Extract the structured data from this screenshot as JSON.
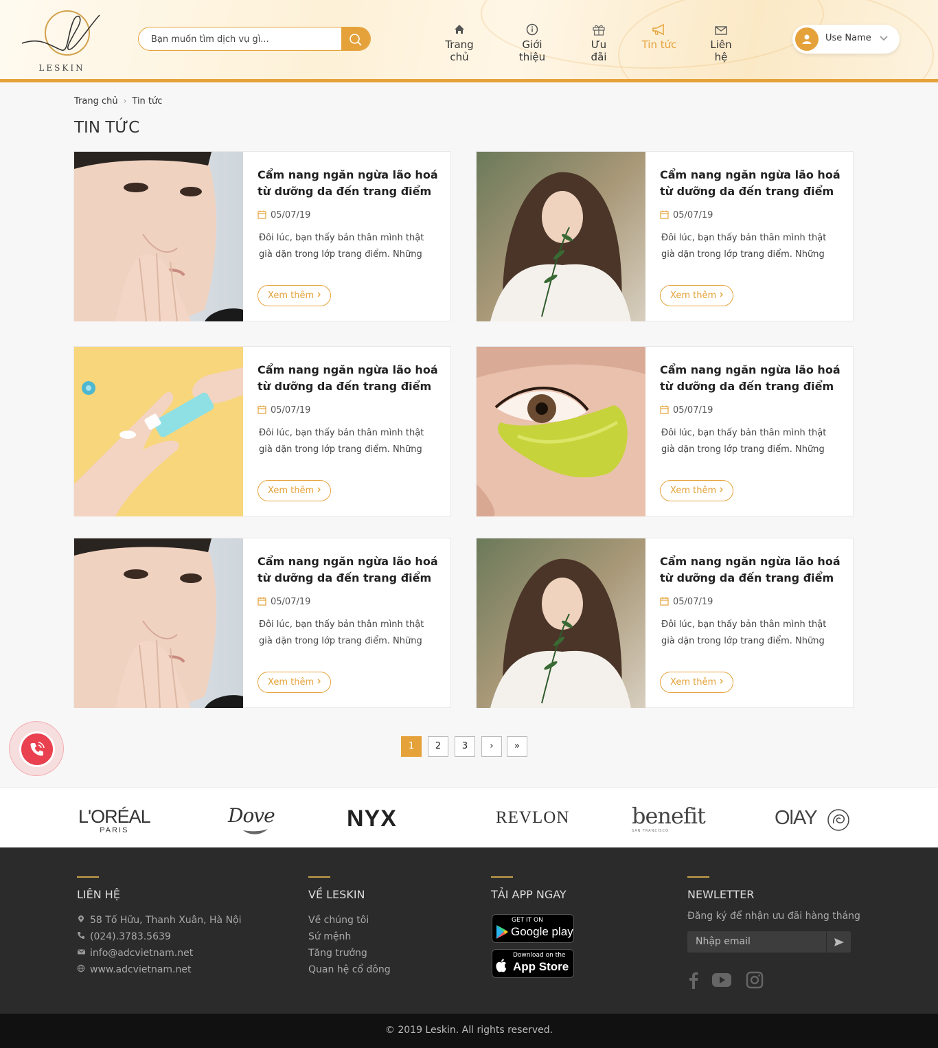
{
  "header": {
    "logo_text": "LESKIN",
    "search_placeholder": "Bạn muốn tìm dịch vụ gì...",
    "nav": [
      {
        "label": "Trang chủ",
        "icon": "home-icon"
      },
      {
        "label": "Giới thiệu",
        "icon": "info-icon"
      },
      {
        "label": "Ưu đãi",
        "icon": "gift-icon"
      },
      {
        "label": "Tin tức",
        "icon": "megaphone-icon",
        "active": true
      },
      {
        "label": "Liên hệ",
        "icon": "mail-icon"
      }
    ],
    "user_name": "Use Name"
  },
  "breadcrumb": {
    "home": "Trang chủ",
    "current": "Tin tức"
  },
  "page_title": "TIN TỨC",
  "articles": [
    {
      "title": "Cẩm nang ngăn ngừa lão hoá từ dưỡng da đến trang điểm",
      "date": "05/07/19",
      "excerpt": "Đôi lúc, bạn thấy bản thân mình thật già dặn trong lớp trang điểm. Những",
      "more": "Xem thêm",
      "image": "face-portrait"
    },
    {
      "title": "Cẩm nang ngăn ngừa lão hoá từ dưỡng da đến trang điểm",
      "date": "05/07/19",
      "excerpt": "Đôi lúc, bạn thấy bản thân mình thật già dặn trong lớp trang điểm. Những",
      "more": "Xem thêm",
      "image": "woman-with-plant"
    },
    {
      "title": "Cẩm nang ngăn ngừa lão hoá từ dưỡng da đến trang điểm",
      "date": "05/07/19",
      "excerpt": "Đôi lúc, bạn thấy bản thân mình thật già dặn trong lớp trang điểm. Những",
      "more": "Xem thêm",
      "image": "hand-cream"
    },
    {
      "title": "Cẩm nang ngăn ngừa lão hoá từ dưỡng da đến trang điểm",
      "date": "05/07/19",
      "excerpt": "Đôi lúc, bạn thấy bản thân mình thật già dặn trong lớp trang điểm. Những",
      "more": "Xem thêm",
      "image": "eye-patch"
    },
    {
      "title": "Cẩm nang ngăn ngừa lão hoá từ dưỡng da đến trang điểm",
      "date": "05/07/19",
      "excerpt": "Đôi lúc, bạn thấy bản thân mình thật già dặn trong lớp trang điểm. Những",
      "more": "Xem thêm",
      "image": "face-portrait"
    },
    {
      "title": "Cẩm nang ngăn ngừa lão hoá từ dưỡng da đến trang điểm",
      "date": "05/07/19",
      "excerpt": "Đôi lúc, bạn thấy bản thân mình thật già dặn trong lớp trang điểm. Những",
      "more": "Xem thêm",
      "image": "woman-with-plant"
    }
  ],
  "pagination": {
    "pages": [
      "1",
      "2",
      "3"
    ],
    "current": "1",
    "next": "›",
    "last": "»"
  },
  "brands": [
    "L'ORÉAL",
    "PARIS",
    "Dove",
    "NYX",
    "REVLON",
    "benefit",
    "SAN FRANCISCO",
    "OlAY"
  ],
  "footer": {
    "contact": {
      "heading": "LIÊN HỆ",
      "address": "58 Tố Hữu, Thanh Xuân, Hà Nội",
      "phone": "(024).3783.5639",
      "email": "info@adcvietnam.net",
      "website": "www.adcvietnam.net"
    },
    "about": {
      "heading": "VỀ LESKIN",
      "links": [
        "Về chúng tôi",
        "Sứ mệnh",
        "Tăng trưởng",
        "Quan hệ cổ đông"
      ]
    },
    "app": {
      "heading": "TẢI APP NGAY",
      "google_small": "GET IT ON",
      "google_big": "Google play",
      "apple_small": "Download on the",
      "apple_big": "App Store"
    },
    "newsletter": {
      "heading": "NEWLETTER",
      "subtitle": "Đăng ký để nhận ưu đãi hàng tháng",
      "placeholder": "Nhập email"
    }
  },
  "copyright": "© 2019 Leskin. All rights reserved.",
  "colors": {
    "accent": "#e5a23a",
    "footer": "#2b2b2b",
    "call": "#e9414f"
  }
}
